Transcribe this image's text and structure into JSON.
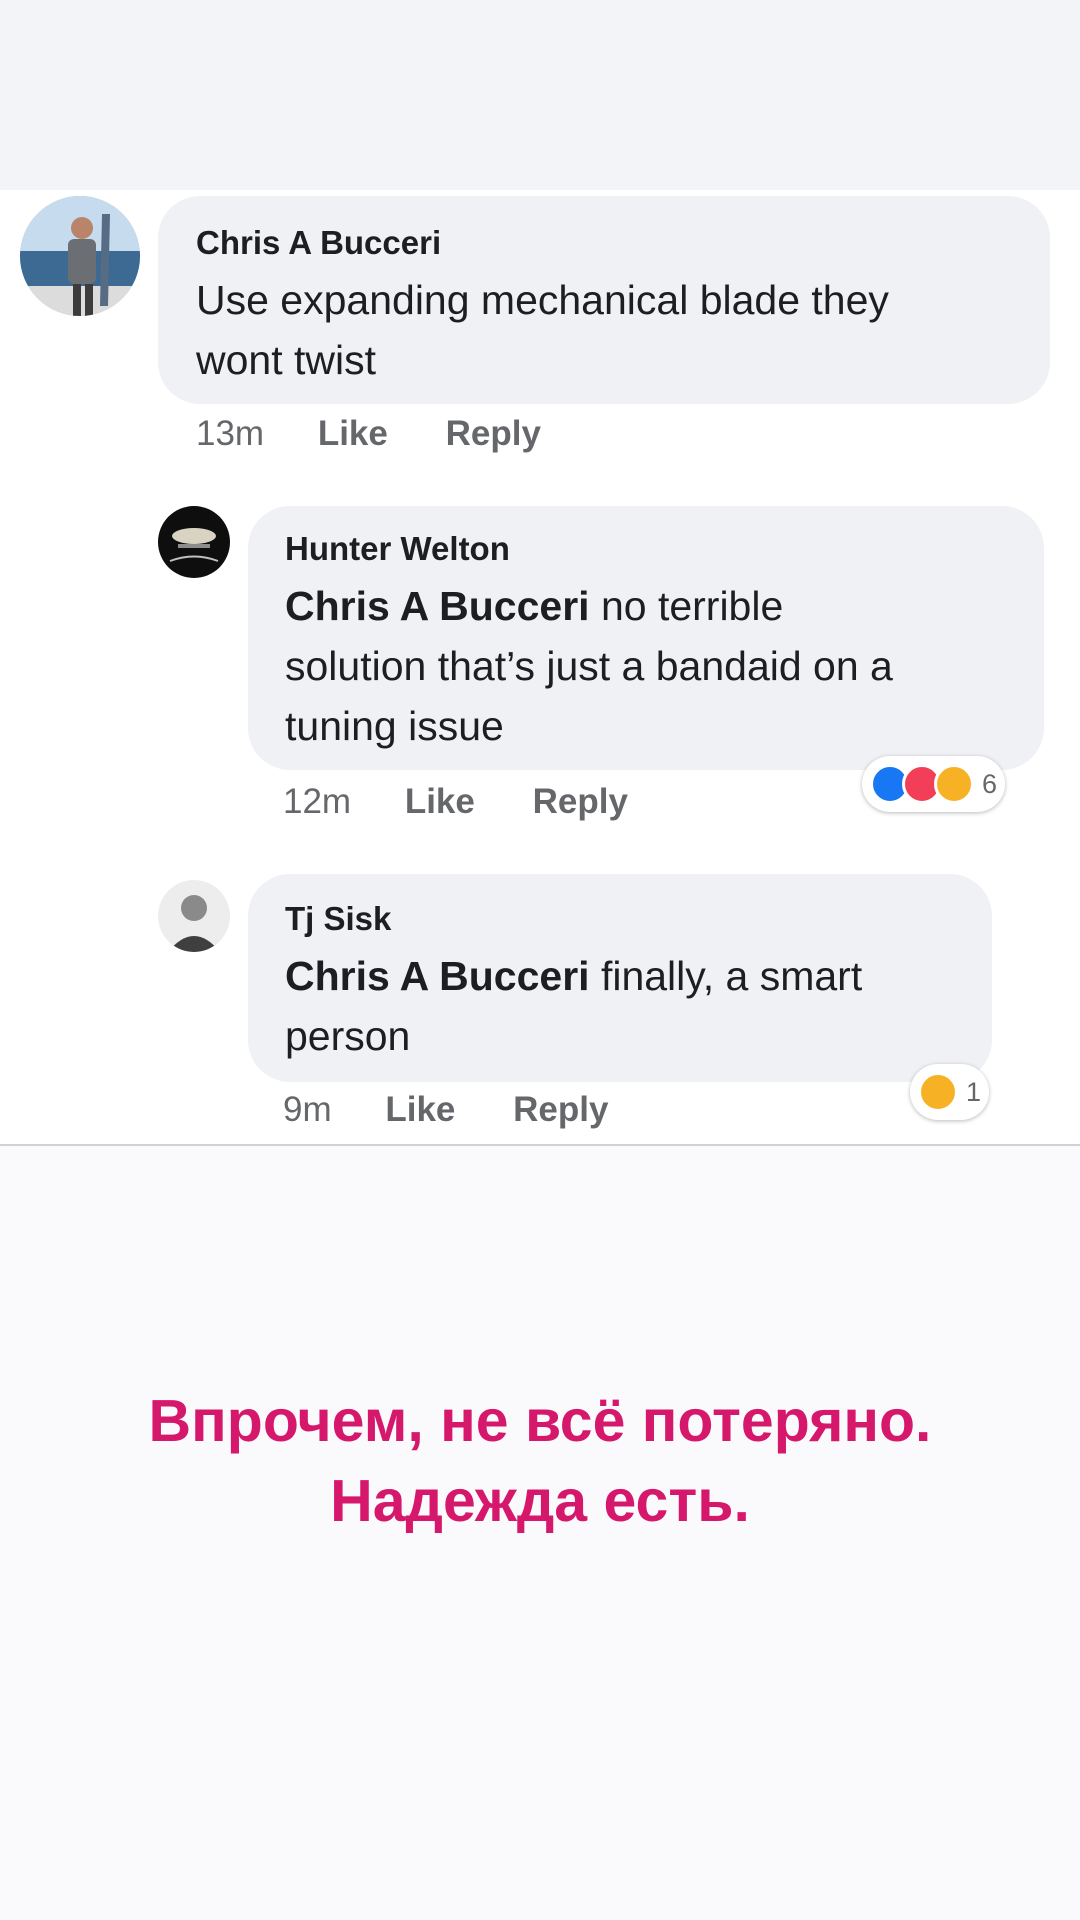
{
  "comments": [
    {
      "author": "Chris A Bucceri",
      "line1": "Use expanding mechanical blade they",
      "line2": "wont twist",
      "time": "13m",
      "like_label": "Like",
      "reply_label": "Reply"
    },
    {
      "author": "Hunter Welton",
      "mention": "Chris A Bucceri",
      "line1_rest": " no terrible",
      "line2": "solution that’s just a bandaid on a",
      "line3": "tuning issue",
      "time": "12m",
      "like_label": "Like",
      "reply_label": "Reply",
      "reaction_count": "6",
      "reaction_icons": [
        "like-icon",
        "love-icon",
        "haha-icon"
      ]
    },
    {
      "author": "Tj Sisk",
      "mention": "Chris A Bucceri",
      "line1_rest": " finally, a smart",
      "line2": "person",
      "time": "9m",
      "like_label": "Like",
      "reply_label": "Reply",
      "reaction_count": "1",
      "reaction_icons": [
        "haha-icon"
      ]
    }
  ],
  "caption": {
    "line1": "Впрочем, не всё потеряно.",
    "line2": "Надежда есть."
  },
  "colors": {
    "caption": "#d6186d",
    "like": "#1877f2",
    "love": "#f33e58",
    "haha": "#f7b125"
  }
}
